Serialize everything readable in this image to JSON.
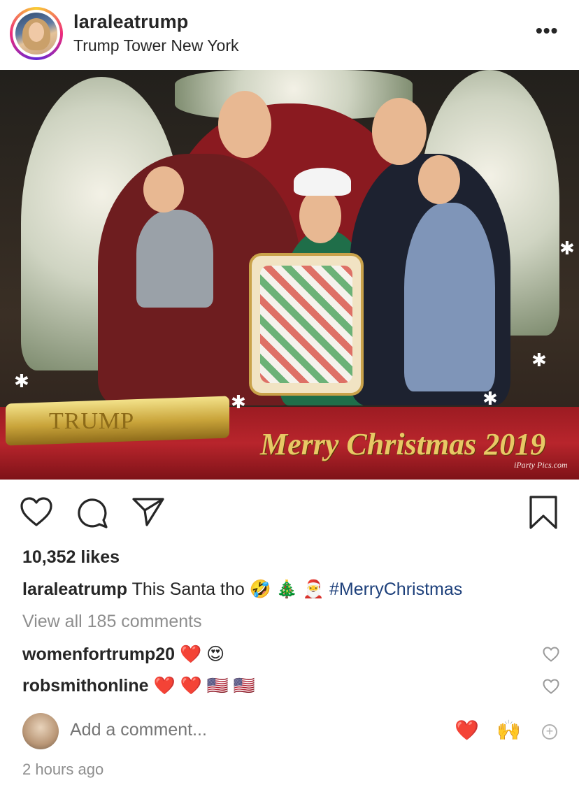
{
  "post": {
    "username": "laraleatrump",
    "location": "Trump Tower New York",
    "more_label": "•••"
  },
  "photo": {
    "scroll_text": "TRUMP",
    "greeting": "Merry Christmas 2019",
    "credit": "iParty Pics.com",
    "colors": {
      "banner": "#b8252c",
      "gold": "#e8c865"
    }
  },
  "actions": {
    "icons": [
      "heart-icon",
      "comment-icon",
      "share-icon",
      "bookmark-icon"
    ]
  },
  "likes": "10,352 likes",
  "caption": {
    "username": "laraleatrump",
    "text": "This Santa tho",
    "emojis": "🤣 🎄 🎅",
    "hashtag": "#MerryChristmas"
  },
  "view_all": "View all 185 comments",
  "comments": [
    {
      "username": "womenfortrump20",
      "text": "❤️ 😍"
    },
    {
      "username": "robsmithonline",
      "text": "❤️ ❤️ 🇺🇸 🇺🇸"
    }
  ],
  "add_comment": {
    "placeholder": "Add a comment...",
    "quick_reactions": [
      "❤️",
      "🙌"
    ]
  },
  "timestamp": "2 hours ago",
  "colors": {
    "text": "#262626",
    "secondary": "#8e8e8e",
    "link": "#1c3f7a"
  }
}
